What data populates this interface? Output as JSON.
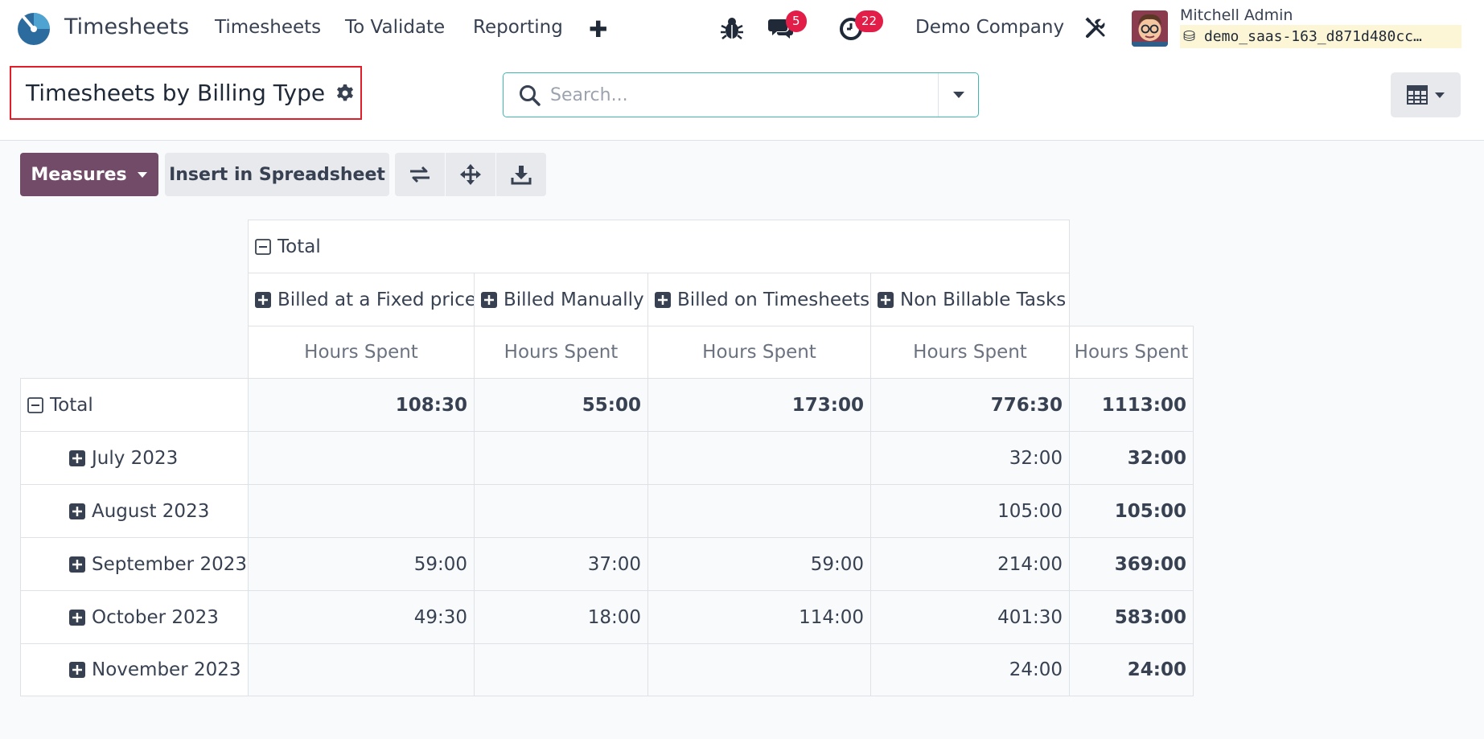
{
  "navbar": {
    "app_name": "Timesheets",
    "menu": [
      "Timesheets",
      "To Validate",
      "Reporting"
    ],
    "messages_badge": "5",
    "activities_badge": "22",
    "company": "Demo Company",
    "user_name": "Mitchell Admin",
    "db_name": "demo_saas-163_d871d480cc…"
  },
  "control_panel": {
    "title": "Timesheets by Billing Type",
    "search_placeholder": "Search..."
  },
  "toolbar": {
    "measures_label": "Measures",
    "insert_label": "Insert in Spreadsheet"
  },
  "pivot": {
    "col_total_label": "Total",
    "columns": [
      "Billed at a Fixed price",
      "Billed Manually",
      "Billed on Timesheets",
      "Non Billable Tasks"
    ],
    "measure": "Hours Spent",
    "row_total_label": "Total",
    "rows": [
      {
        "label": "Total",
        "values": [
          "108:30",
          "55:00",
          "173:00",
          "776:30",
          "1113:00"
        ]
      },
      {
        "label": "July 2023",
        "values": [
          "",
          "",
          "",
          "32:00",
          "32:00"
        ]
      },
      {
        "label": "August 2023",
        "values": [
          "",
          "",
          "",
          "105:00",
          "105:00"
        ]
      },
      {
        "label": "September 2023",
        "values": [
          "59:00",
          "37:00",
          "59:00",
          "214:00",
          "369:00"
        ]
      },
      {
        "label": "October 2023",
        "values": [
          "49:30",
          "18:00",
          "114:00",
          "401:30",
          "583:00"
        ]
      },
      {
        "label": "November 2023",
        "values": [
          "",
          "",
          "",
          "24:00",
          "24:00"
        ]
      }
    ]
  },
  "colors": {
    "primary": "#714b67",
    "badge": "#e11d48",
    "highlight_border": "#e11d2a"
  }
}
